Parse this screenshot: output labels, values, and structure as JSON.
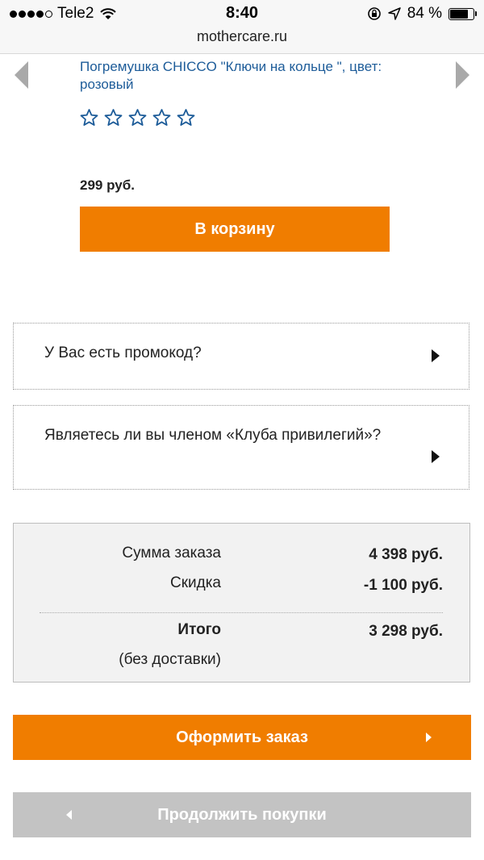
{
  "status_bar": {
    "carrier": "Tele2",
    "time": "8:40",
    "battery": "84 %",
    "signal_icon": "signal-dots-icon",
    "wifi_icon": "wifi-icon",
    "lock_icon": "rotation-lock-icon",
    "location_icon": "location-arrow-icon",
    "battery_icon": "battery-icon"
  },
  "browser": {
    "url": "mothercare.ru"
  },
  "product": {
    "title": "Погремушка CHICCO \"Ключи на кольце \", цвет: розовый",
    "rating_stars": 0,
    "rating_max": 5,
    "price": "299 руб.",
    "add_to_cart": "В корзину",
    "prev_icon": "chevron-left-icon",
    "next_icon": "chevron-right-icon"
  },
  "promo": {
    "label": "У Вас есть промокод?"
  },
  "club": {
    "label": "Являетесь ли вы членом «Клуба привилегий»?"
  },
  "summary": {
    "order_sum_label": "Сумма заказа",
    "order_sum_value": "4 398 руб.",
    "discount_label": "Скидка",
    "discount_value": "-1 100 руб.",
    "total_label": "Итого",
    "total_note": "(без доставки)",
    "total_value": "3 298 руб."
  },
  "actions": {
    "checkout": "Оформить заказ",
    "continue_shopping": "Продолжить покупки"
  },
  "colors": {
    "accent_orange": "#f07d00",
    "link_blue": "#1d5c99",
    "disabled_gray": "#c3c3c3",
    "summary_bg": "#f2f2f2"
  }
}
